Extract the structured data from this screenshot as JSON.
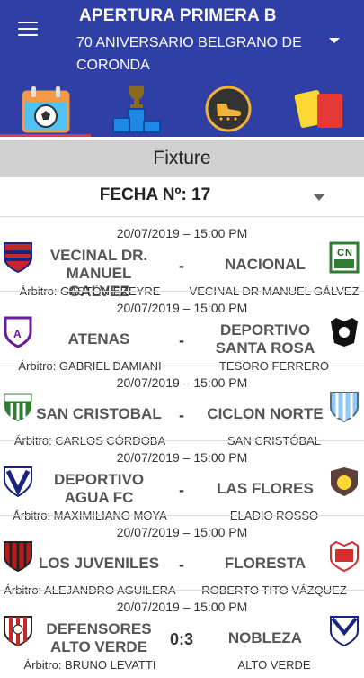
{
  "header": {
    "title": "APERTURA PRIMERA B",
    "subtitle": "70 ANIVERSARIO BELGRANO DE CORONDA"
  },
  "tabs": [
    {
      "name": "fixture",
      "icon": "calendar-ball-icon",
      "active": true
    },
    {
      "name": "standings",
      "icon": "podium-trophy-icon",
      "active": false
    },
    {
      "name": "scorers",
      "icon": "golden-boot-icon",
      "active": false
    },
    {
      "name": "cards",
      "icon": "yellow-red-cards-icon",
      "active": false
    }
  ],
  "colors": {
    "primary": "#2f3fa6",
    "accent": "#e53935",
    "section": "#d0d0d0"
  },
  "section": {
    "title": "Fixture"
  },
  "fecha": {
    "label": "FECHA Nº: 17"
  },
  "matches": [
    {
      "date": "20/07/2019  –  15:00 PM",
      "home": "VECINAL DR. MANUEL GALVEZ",
      "away": "NACIONAL",
      "score": "-",
      "referee": "Árbitro: GASTÓN FREYRE",
      "venue": "VECINAL DR MANUEL GÁLVEZ"
    },
    {
      "date": "20/07/2019  –  15:00 PM",
      "home": "ATENAS",
      "away": "DEPORTIVO SANTA ROSA",
      "score": "-",
      "referee": "Árbitro: GABRIEL DAMIANI",
      "venue": "TESORO FERRERO"
    },
    {
      "date": "20/07/2019  –  15:00 PM",
      "home": "SAN CRISTOBAL",
      "away": "CICLON NORTE",
      "score": "-",
      "referee": "Árbitro: CARLOS CÓRDOBA",
      "venue": "SAN CRISTÓBAL"
    },
    {
      "date": "20/07/2019  –  15:00 PM",
      "home": "DEPORTIVO AGUA FC",
      "away": "LAS FLORES",
      "score": "-",
      "referee": "Árbitro: MAXIMILIANO MOYA",
      "venue": "ELADIO ROSSO"
    },
    {
      "date": "20/07/2019  –  15:00 PM",
      "home": "LOS JUVENILES",
      "away": "FLORESTA",
      "score": "-",
      "referee": "Árbitro: ALEJANDRO AGUILERA",
      "venue": "ROBERTO TITO VÁZQUEZ"
    },
    {
      "date": "20/07/2019  –  15:00 PM",
      "home": "DEFENSORES ALTO VERDE",
      "away": "NOBLEZA",
      "score": "0:3",
      "referee": "Árbitro: BRUNO LEVATTI",
      "venue": "ALTO VERDE"
    }
  ]
}
